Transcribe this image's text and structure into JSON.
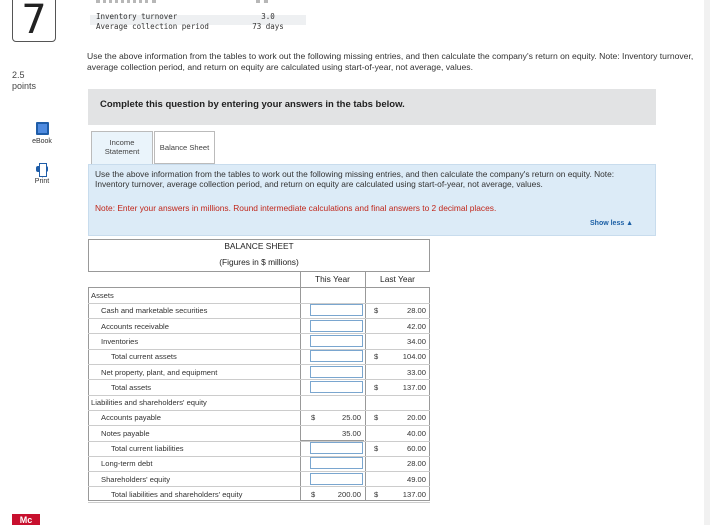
{
  "question": {
    "number": "7",
    "points": "2.5",
    "points_label": "points",
    "text": "Use the above information from the tables to work out the following missing entries, and then calculate the company's return on equity. Note: Inventory turnover, average collection period, and return on equity are calculated using start-of-year, not average, values."
  },
  "tools": {
    "ebook": "eBook",
    "print": "Print"
  },
  "prior_table": {
    "rows": [
      {
        "label": "Inventory turnover",
        "value": "3.0"
      },
      {
        "label": "Average collection period",
        "value": "73 days"
      }
    ]
  },
  "instruction_bar": "Complete this question by entering your answers in the tabs below.",
  "tabs": [
    {
      "label_line1": "Income",
      "label_line2": "Statement"
    },
    {
      "label": "Balance Sheet"
    }
  ],
  "panel": {
    "text": "Use the above information from the tables to work out the following missing entries, and then calculate the company's return on equity. Note: Inventory turnover, average collection period, and return on equity are calculated using start-of-year, not average, values.",
    "note": "Note: Enter your answers in millions. Round intermediate calculations and final answers to 2 decimal places.",
    "show_less": "Show less ▲"
  },
  "balance_sheet": {
    "title": "BALANCE SHEET",
    "subtitle": "(Figures in $ millions)",
    "col_this_year": "This Year",
    "col_last_year": "Last Year",
    "rows": [
      {
        "label": "Assets",
        "indent": 0,
        "this_year": "",
        "ty_input": false,
        "ty_dollar": false,
        "last_year": "",
        "ly_dollar": false
      },
      {
        "label": "Cash and marketable securities",
        "indent": 1,
        "this_year": "",
        "ty_input": true,
        "ty_dollar": false,
        "last_year": "28.00",
        "ly_dollar": true
      },
      {
        "label": "Accounts receivable",
        "indent": 1,
        "this_year": "",
        "ty_input": true,
        "ty_dollar": false,
        "last_year": "42.00",
        "ly_dollar": false
      },
      {
        "label": "Inventories",
        "indent": 1,
        "this_year": "",
        "ty_input": true,
        "ty_dollar": false,
        "last_year": "34.00",
        "ly_dollar": false
      },
      {
        "label": "Total current assets",
        "indent": 2,
        "this_year": "",
        "ty_input": true,
        "ty_dollar": false,
        "last_year": "104.00",
        "ly_dollar": true
      },
      {
        "label": "Net property, plant, and equipment",
        "indent": 1,
        "this_year": "",
        "ty_input": true,
        "ty_dollar": false,
        "last_year": "33.00",
        "ly_dollar": false
      },
      {
        "label": "Total assets",
        "indent": 2,
        "this_year": "",
        "ty_input": true,
        "ty_dollar": false,
        "last_year": "137.00",
        "ly_dollar": true
      },
      {
        "label": "Liabilities and shareholders' equity",
        "indent": 0,
        "this_year": "",
        "ty_input": false,
        "ty_dollar": false,
        "last_year": "",
        "ly_dollar": false
      },
      {
        "label": "Accounts payable",
        "indent": 1,
        "this_year": "25.00",
        "ty_input": false,
        "ty_dollar": true,
        "last_year": "20.00",
        "ly_dollar": true
      },
      {
        "label": "Notes payable",
        "indent": 1,
        "this_year": "35.00",
        "ty_input": false,
        "ty_dollar": false,
        "last_year": "40.00",
        "ly_dollar": false
      },
      {
        "label": "Total current liabilities",
        "indent": 2,
        "this_year": "",
        "ty_input": true,
        "ty_dollar": false,
        "last_year": "60.00",
        "ly_dollar": true
      },
      {
        "label": "Long-term debt",
        "indent": 1,
        "this_year": "",
        "ty_input": true,
        "ty_dollar": false,
        "last_year": "28.00",
        "ly_dollar": false
      },
      {
        "label": "Shareholders' equity",
        "indent": 1,
        "this_year": "",
        "ty_input": true,
        "ty_dollar": false,
        "last_year": "49.00",
        "ly_dollar": false
      },
      {
        "label": "Total liabilities and shareholders' equity",
        "indent": 2,
        "this_year": "200.00",
        "ty_input": false,
        "ty_dollar": true,
        "last_year": "137.00",
        "ly_dollar": true
      }
    ]
  },
  "dollar_sign": "$",
  "footer": {
    "logo": "Mc"
  }
}
